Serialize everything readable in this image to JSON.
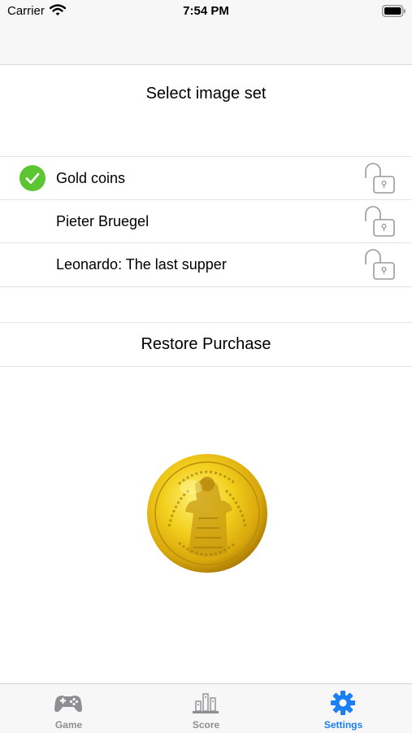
{
  "status_bar": {
    "carrier": "Carrier",
    "time": "7:54 PM"
  },
  "section": {
    "title": "Select image set"
  },
  "image_sets": [
    {
      "label": "Gold coins",
      "selected": true,
      "locked": false
    },
    {
      "label": "Pieter Bruegel",
      "selected": false,
      "locked": false
    },
    {
      "label": "Leonardo: The last supper",
      "selected": false,
      "locked": false
    }
  ],
  "restore": {
    "label": "Restore Purchase"
  },
  "tab_bar": {
    "tabs": [
      {
        "label": "Game",
        "icon": "gamepad-icon",
        "active": false
      },
      {
        "label": "Score",
        "icon": "score-bars-icon",
        "active": false
      },
      {
        "label": "Settings",
        "icon": "gear-icon",
        "active": true
      }
    ],
    "active_color": "#1a7ff5",
    "inactive_color": "#8e8e93"
  },
  "colors": {
    "check": "#5cc532",
    "lock": "#9a9a9a"
  }
}
